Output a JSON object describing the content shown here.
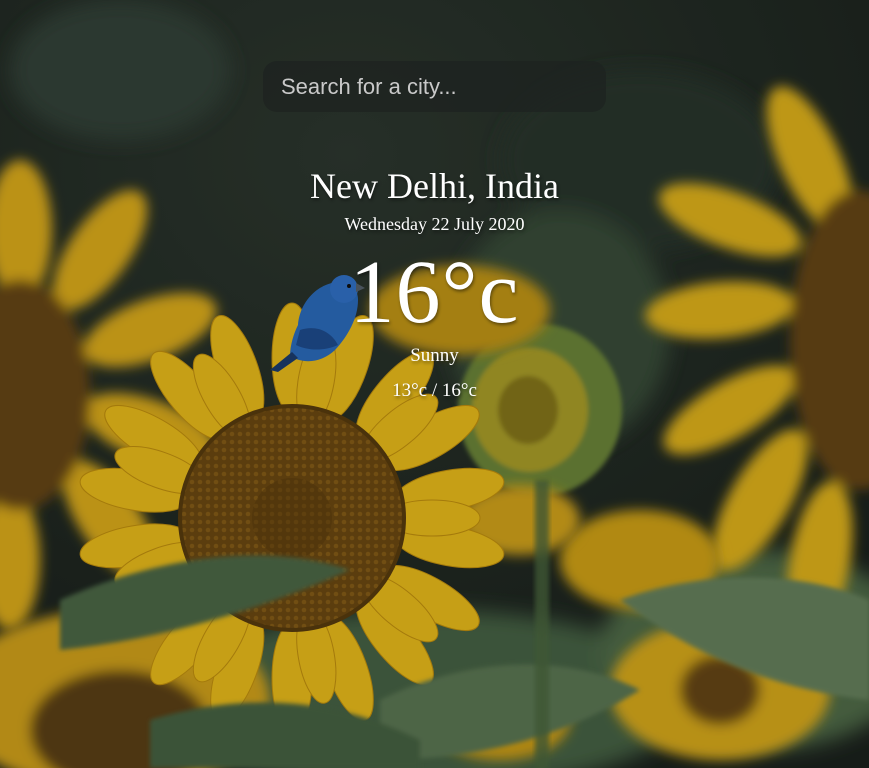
{
  "search": {
    "placeholder": "Search for a city...",
    "value": ""
  },
  "weather": {
    "location": "New Delhi, India",
    "date": "Wednesday 22 July 2020",
    "temperature": "16°c",
    "condition": "Sunny",
    "min_max": "13°c / 16°c"
  },
  "colors": {
    "text": "#ffffff",
    "search_background": "#1e2220",
    "sunflower_yellow": "#f2c21b",
    "sunflower_center": "#6b4a12",
    "foliage": "#3f5a3f",
    "background_dark": "#26312a"
  }
}
